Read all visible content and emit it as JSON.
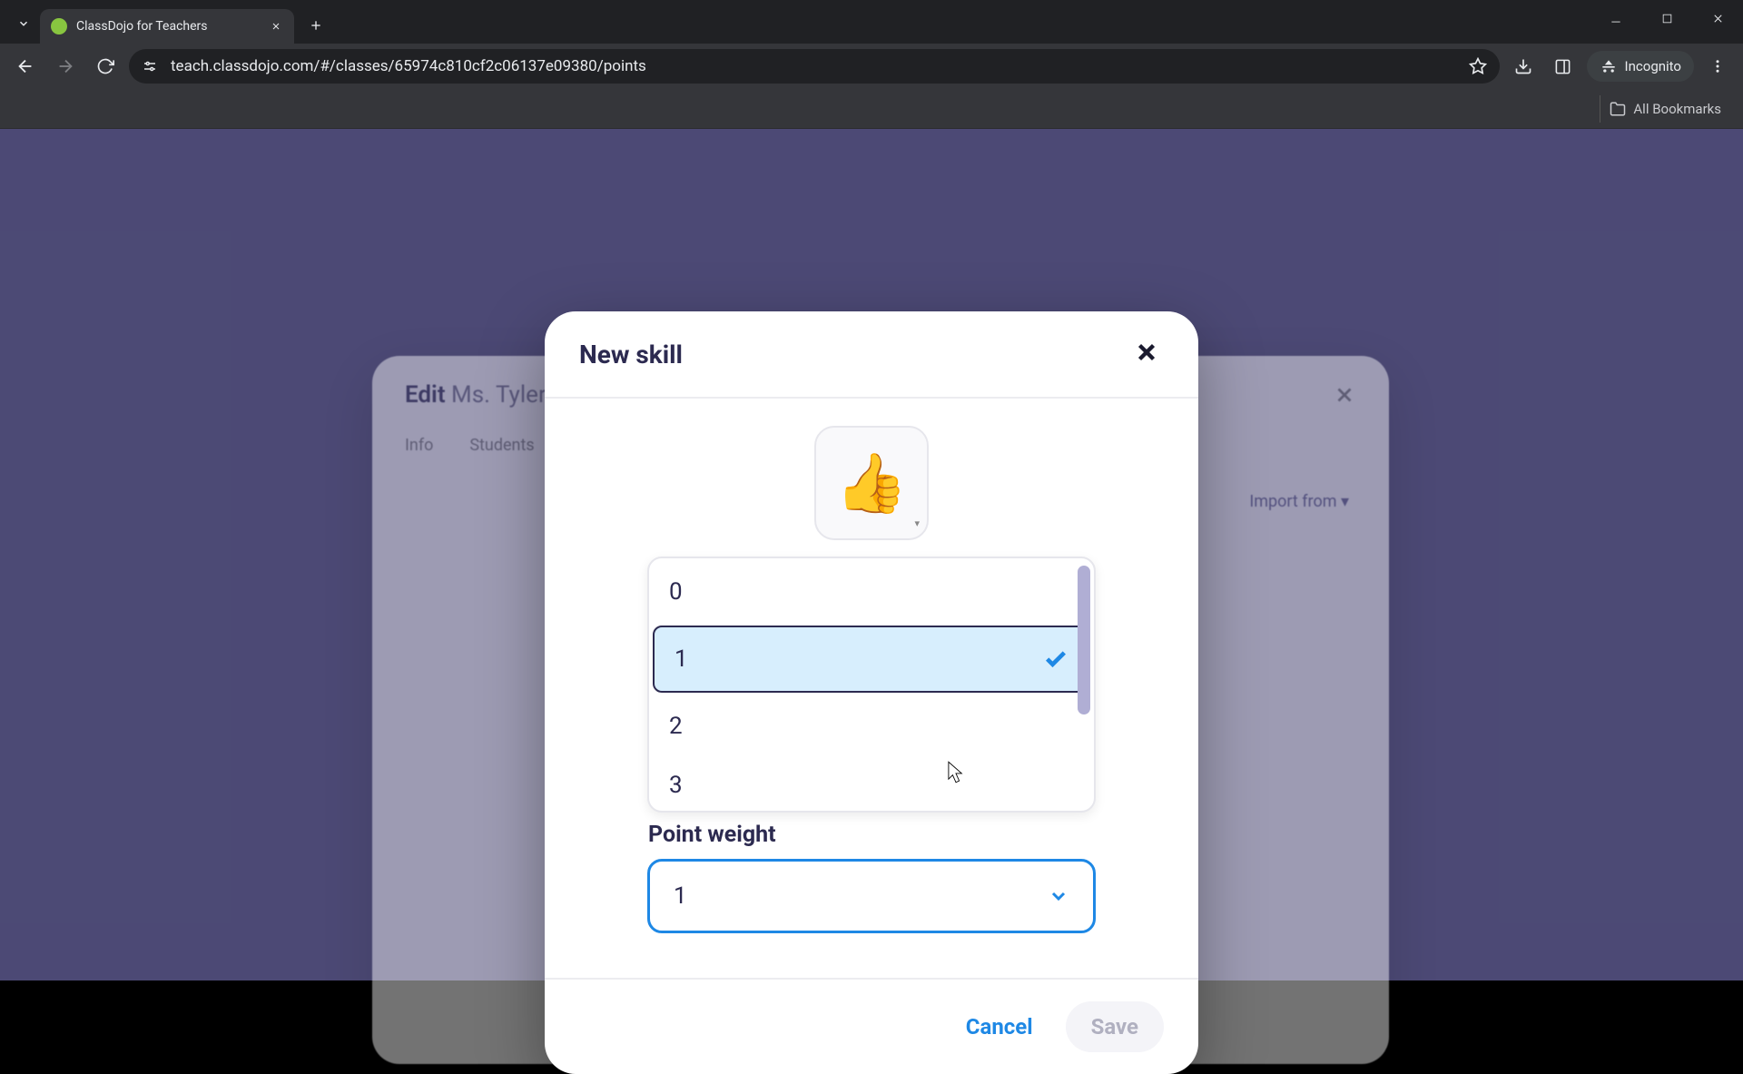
{
  "browser": {
    "tab_title": "ClassDojo for Teachers",
    "url": "teach.classdojo.com/#/classes/65974c810cf2c06137e09380/points",
    "incognito_label": "Incognito",
    "bookmarks_all": "All Bookmarks"
  },
  "edit_dialog": {
    "title_prefix": "Edit",
    "title_class": "Ms. Tyler's",
    "tab_info": "Info",
    "tab_students": "Students",
    "import": "Import from"
  },
  "modal": {
    "title": "New skill",
    "point_weight_label": "Point weight",
    "selected_value": "1",
    "options": [
      "0",
      "1",
      "2",
      "3"
    ],
    "cancel": "Cancel",
    "save": "Save"
  }
}
